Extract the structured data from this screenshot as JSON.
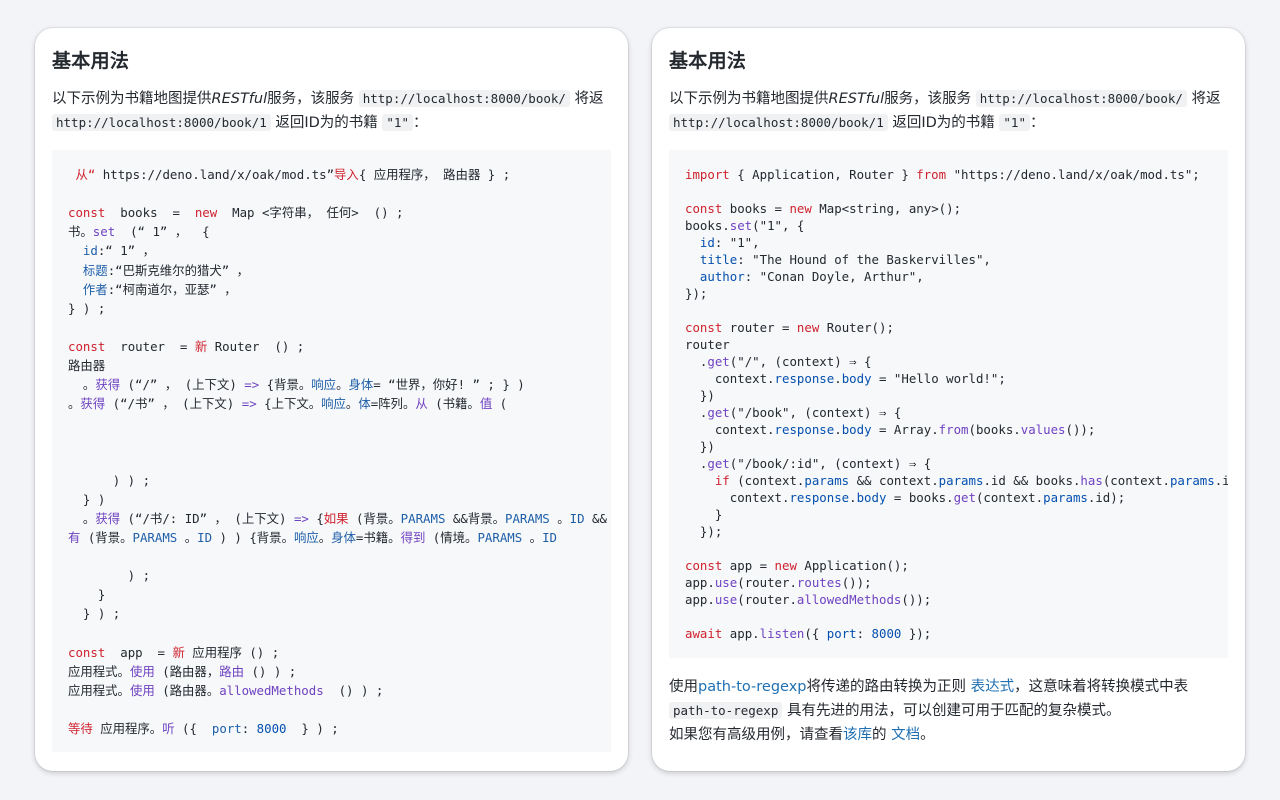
{
  "left": {
    "title": "基本用法",
    "intro_line1_pre": "以下示例为书籍地图提供",
    "intro_line1_em": "RESTful",
    "intro_line1_mid": "服务，该服务",
    "intro_code1": "http://localhost:8000/book/",
    "intro_line1_post": "将返",
    "intro_code2": "http://localhost:8000/book/1",
    "intro_line2_post": "返回ID为的书籍",
    "intro_code3": "\"1\"",
    "intro_line2_end": "：",
    "code_lines": [
      [
        {
          "t": " ",
          "c": ""
        },
        {
          "t": "从“",
          "c": "k"
        },
        {
          "t": " https://deno.land/x/oak/mod.ts”",
          "c": "s"
        },
        {
          "t": "导入",
          "c": "k"
        },
        {
          "t": "{ 应用程序， 路由器 } ;",
          "c": "s"
        }
      ],
      [],
      [
        {
          "t": "const",
          "c": "k"
        },
        {
          "t": "  books  = ",
          "c": "s"
        },
        {
          "t": " new",
          "c": "k"
        },
        {
          "t": "  Map <字符串， 任何>  () ;",
          "c": "s"
        }
      ],
      [
        {
          "t": "书。",
          "c": "s"
        },
        {
          "t": "set",
          "c": "f"
        },
        {
          "t": "  (“ 1” ，  {",
          "c": "s"
        }
      ],
      [
        {
          "t": "  ",
          "c": "s"
        },
        {
          "t": "id",
          "c": "p"
        },
        {
          "t": ":“ 1” ，",
          "c": "s"
        }
      ],
      [
        {
          "t": "  ",
          "c": "s"
        },
        {
          "t": "标题",
          "c": "p"
        },
        {
          "t": ":“巴斯克维尔的猎犬” ，",
          "c": "s"
        }
      ],
      [
        {
          "t": "  ",
          "c": "s"
        },
        {
          "t": "作者",
          "c": "p"
        },
        {
          "t": ":“柯南道尔，亚瑟” ，",
          "c": "s"
        }
      ],
      [
        {
          "t": "} ) ;",
          "c": "s"
        }
      ],
      [],
      [
        {
          "t": "const",
          "c": "k"
        },
        {
          "t": "  router  = ",
          "c": "s"
        },
        {
          "t": "新",
          "c": "k"
        },
        {
          "t": " Router  () ;",
          "c": "s"
        }
      ],
      [
        {
          "t": "路由器",
          "c": "s"
        }
      ],
      [
        {
          "t": "  。",
          "c": "s"
        },
        {
          "t": "获得",
          "c": "f"
        },
        {
          "t": " (“/” ， (上下文) ",
          "c": "s"
        },
        {
          "t": "=>",
          "c": "f"
        },
        {
          "t": " {背景。",
          "c": "s"
        },
        {
          "t": "响应",
          "c": "p"
        },
        {
          "t": "。",
          "c": "s"
        },
        {
          "t": "身体",
          "c": "p"
        },
        {
          "t": "= “世界，你好! ” ; } )",
          "c": "s"
        }
      ],
      [
        {
          "t": "。",
          "c": "s"
        },
        {
          "t": "获得",
          "c": "f"
        },
        {
          "t": " (“/书” ， (上下文) ",
          "c": "s"
        },
        {
          "t": "=>",
          "c": "f"
        },
        {
          "t": " {上下文。",
          "c": "s"
        },
        {
          "t": "响应",
          "c": "p"
        },
        {
          "t": "。",
          "c": "s"
        },
        {
          "t": "体",
          "c": "p"
        },
        {
          "t": "=阵列。",
          "c": "s"
        },
        {
          "t": "从",
          "c": "f"
        },
        {
          "t": " (书籍。",
          "c": "s"
        },
        {
          "t": "值",
          "c": "f"
        },
        {
          "t": " (",
          "c": "s"
        }
      ],
      [],
      [],
      [],
      [
        {
          "t": "      ) ) ;",
          "c": "s"
        }
      ],
      [
        {
          "t": "  } )",
          "c": "s"
        }
      ],
      [
        {
          "t": "  。",
          "c": "s"
        },
        {
          "t": "获得",
          "c": "f"
        },
        {
          "t": " (“/书/: ID” ， (上下文) ",
          "c": "s"
        },
        {
          "t": "=>",
          "c": "f"
        },
        {
          "t": " {",
          "c": "s"
        },
        {
          "t": "如果",
          "c": "k"
        },
        {
          "t": " (背景。",
          "c": "s"
        },
        {
          "t": "PARAMS",
          "c": "p"
        },
        {
          "t": " &&背景。",
          "c": "s"
        },
        {
          "t": "PARAMS",
          "c": "p"
        },
        {
          "t": " 。",
          "c": "s"
        },
        {
          "t": "ID",
          "c": "p"
        },
        {
          "t": " &&",
          "c": "s"
        }
      ],
      [
        {
          "t": "有",
          "c": "f"
        },
        {
          "t": " (背景。",
          "c": "s"
        },
        {
          "t": "PARAMS",
          "c": "p"
        },
        {
          "t": " 。",
          "c": "s"
        },
        {
          "t": "ID",
          "c": "p"
        },
        {
          "t": " ) ) {背景。",
          "c": "s"
        },
        {
          "t": "响应",
          "c": "p"
        },
        {
          "t": "。",
          "c": "s"
        },
        {
          "t": "身体",
          "c": "p"
        },
        {
          "t": "=书籍。",
          "c": "s"
        },
        {
          "t": "得到",
          "c": "f"
        },
        {
          "t": " (情境。",
          "c": "s"
        },
        {
          "t": "PARAMS",
          "c": "p"
        },
        {
          "t": " 。",
          "c": "s"
        },
        {
          "t": "ID",
          "c": "p"
        }
      ],
      [],
      [
        {
          "t": "        ) ;",
          "c": "s"
        }
      ],
      [
        {
          "t": "    }",
          "c": "s"
        }
      ],
      [
        {
          "t": "  } ) ;",
          "c": "s"
        }
      ],
      [],
      [
        {
          "t": "const",
          "c": "k"
        },
        {
          "t": "  app  = ",
          "c": "s"
        },
        {
          "t": "新",
          "c": "k"
        },
        {
          "t": " 应用程序 () ;",
          "c": "s"
        }
      ],
      [
        {
          "t": "应用程式。",
          "c": "s"
        },
        {
          "t": "使用",
          "c": "f"
        },
        {
          "t": " (路由器，",
          "c": "s"
        },
        {
          "t": "路由",
          "c": "f"
        },
        {
          "t": " () ) ;",
          "c": "s"
        }
      ],
      [
        {
          "t": "应用程式。",
          "c": "s"
        },
        {
          "t": "使用",
          "c": "f"
        },
        {
          "t": " (路由器。",
          "c": "s"
        },
        {
          "t": "allowedMethods",
          "c": "f"
        },
        {
          "t": "  () ) ;",
          "c": "s"
        }
      ],
      [],
      [
        {
          "t": "等待",
          "c": "k"
        },
        {
          "t": " 应用程序。",
          "c": "s"
        },
        {
          "t": "听",
          "c": "f"
        },
        {
          "t": " ({  ",
          "c": "s"
        },
        {
          "t": "port",
          "c": "p"
        },
        {
          "t": ": ",
          "c": "s"
        },
        {
          "t": "8000",
          "c": "n"
        },
        {
          "t": "  } ) ;",
          "c": "s"
        }
      ]
    ]
  },
  "right": {
    "title": "基本用法",
    "intro_line1_pre": "以下示例为书籍地图提供",
    "intro_line1_em": "RESTful",
    "intro_line1_mid": "服务，该服务",
    "intro_code1": "http://localhost:8000/book/",
    "intro_line1_post": "将返",
    "intro_code2": "http://localhost:8000/book/1",
    "intro_line2_post": "返回ID为的书籍",
    "intro_code3": "\"1\"",
    "intro_line2_end": "：",
    "code_lines": [
      [
        {
          "t": "import",
          "c": "k"
        },
        {
          "t": " { Application, Router } ",
          "c": "s"
        },
        {
          "t": "from",
          "c": "k"
        },
        {
          "t": " \"https://deno.land/x/oak/mod.ts\";",
          "c": "s"
        }
      ],
      [],
      [
        {
          "t": "const",
          "c": "k"
        },
        {
          "t": " books = ",
          "c": "s"
        },
        {
          "t": "new",
          "c": "k"
        },
        {
          "t": " Map<string, any>();",
          "c": "s"
        }
      ],
      [
        {
          "t": "books.",
          "c": "s"
        },
        {
          "t": "set",
          "c": "f"
        },
        {
          "t": "(\"1\", {",
          "c": "s"
        }
      ],
      [
        {
          "t": "  ",
          "c": "s"
        },
        {
          "t": "id",
          "c": "p"
        },
        {
          "t": ": \"1\",",
          "c": "s"
        }
      ],
      [
        {
          "t": "  ",
          "c": "s"
        },
        {
          "t": "title",
          "c": "p"
        },
        {
          "t": ": \"The Hound of the Baskervilles\",",
          "c": "s"
        }
      ],
      [
        {
          "t": "  ",
          "c": "s"
        },
        {
          "t": "author",
          "c": "p"
        },
        {
          "t": ": \"Conan Doyle, Arthur\",",
          "c": "s"
        }
      ],
      [
        {
          "t": "});",
          "c": "s"
        }
      ],
      [],
      [
        {
          "t": "const",
          "c": "k"
        },
        {
          "t": " router = ",
          "c": "s"
        },
        {
          "t": "new",
          "c": "k"
        },
        {
          "t": " Router();",
          "c": "s"
        }
      ],
      [
        {
          "t": "router",
          "c": "s"
        }
      ],
      [
        {
          "t": "  .",
          "c": "s"
        },
        {
          "t": "get",
          "c": "f"
        },
        {
          "t": "(\"/\", (context) ⇒ {",
          "c": "s"
        }
      ],
      [
        {
          "t": "    context.",
          "c": "s"
        },
        {
          "t": "response",
          "c": "p"
        },
        {
          "t": ".",
          "c": "s"
        },
        {
          "t": "body",
          "c": "p"
        },
        {
          "t": " = \"Hello world!\";",
          "c": "s"
        }
      ],
      [
        {
          "t": "  })",
          "c": "s"
        }
      ],
      [
        {
          "t": "  .",
          "c": "s"
        },
        {
          "t": "get",
          "c": "f"
        },
        {
          "t": "(\"/book\", (context) ⇒ {",
          "c": "s"
        }
      ],
      [
        {
          "t": "    context.",
          "c": "s"
        },
        {
          "t": "response",
          "c": "p"
        },
        {
          "t": ".",
          "c": "s"
        },
        {
          "t": "body",
          "c": "p"
        },
        {
          "t": " = Array.",
          "c": "s"
        },
        {
          "t": "from",
          "c": "f"
        },
        {
          "t": "(books.",
          "c": "s"
        },
        {
          "t": "values",
          "c": "f"
        },
        {
          "t": "());",
          "c": "s"
        }
      ],
      [
        {
          "t": "  })",
          "c": "s"
        }
      ],
      [
        {
          "t": "  .",
          "c": "s"
        },
        {
          "t": "get",
          "c": "f"
        },
        {
          "t": "(\"/book/:id\", (context) ⇒ {",
          "c": "s"
        }
      ],
      [
        {
          "t": "    ",
          "c": "s"
        },
        {
          "t": "if",
          "c": "k"
        },
        {
          "t": " (context.",
          "c": "s"
        },
        {
          "t": "params",
          "c": "p"
        },
        {
          "t": " && context.",
          "c": "s"
        },
        {
          "t": "params",
          "c": "p"
        },
        {
          "t": ".id && books.",
          "c": "s"
        },
        {
          "t": "has",
          "c": "f"
        },
        {
          "t": "(context.",
          "c": "s"
        },
        {
          "t": "params",
          "c": "p"
        },
        {
          "t": ".id)) {",
          "c": "s"
        }
      ],
      [
        {
          "t": "      context.",
          "c": "s"
        },
        {
          "t": "response",
          "c": "p"
        },
        {
          "t": ".",
          "c": "s"
        },
        {
          "t": "body",
          "c": "p"
        },
        {
          "t": " = books.",
          "c": "s"
        },
        {
          "t": "get",
          "c": "f"
        },
        {
          "t": "(context.",
          "c": "s"
        },
        {
          "t": "params",
          "c": "p"
        },
        {
          "t": ".id);",
          "c": "s"
        }
      ],
      [
        {
          "t": "    }",
          "c": "s"
        }
      ],
      [
        {
          "t": "  });",
          "c": "s"
        }
      ],
      [],
      [
        {
          "t": "const",
          "c": "k"
        },
        {
          "t": " app = ",
          "c": "s"
        },
        {
          "t": "new",
          "c": "k"
        },
        {
          "t": " Application();",
          "c": "s"
        }
      ],
      [
        {
          "t": "app.",
          "c": "s"
        },
        {
          "t": "use",
          "c": "f"
        },
        {
          "t": "(router.",
          "c": "s"
        },
        {
          "t": "routes",
          "c": "f"
        },
        {
          "t": "());",
          "c": "s"
        }
      ],
      [
        {
          "t": "app.",
          "c": "s"
        },
        {
          "t": "use",
          "c": "f"
        },
        {
          "t": "(router.",
          "c": "s"
        },
        {
          "t": "allowedMethods",
          "c": "f"
        },
        {
          "t": "());",
          "c": "s"
        }
      ],
      [],
      [
        {
          "t": "await",
          "c": "k"
        },
        {
          "t": " app.",
          "c": "s"
        },
        {
          "t": "listen",
          "c": "f"
        },
        {
          "t": "({ ",
          "c": "s"
        },
        {
          "t": "port",
          "c": "p"
        },
        {
          "t": ": ",
          "c": "s"
        },
        {
          "t": "8000",
          "c": "n"
        },
        {
          "t": " });",
          "c": "s"
        }
      ]
    ],
    "outro_1_pre": "使用",
    "outro_1_link": "path-to-regexp",
    "outro_1_mid": "将传递的路由转换为正则 ",
    "outro_1_link2": "表达式",
    "outro_1_post": "，这意味着将转换模式中表",
    "outro_2_code": "path-to-regexp",
    "outro_2_post": "具有先进的用法，可以创建可用于匹配的复杂模式。",
    "outro_3_pre": "如果您有高级用例，请查看",
    "outro_3_link": "该库",
    "outro_3_mid": "的 ",
    "outro_3_link2": "文档",
    "outro_3_post": "。"
  }
}
